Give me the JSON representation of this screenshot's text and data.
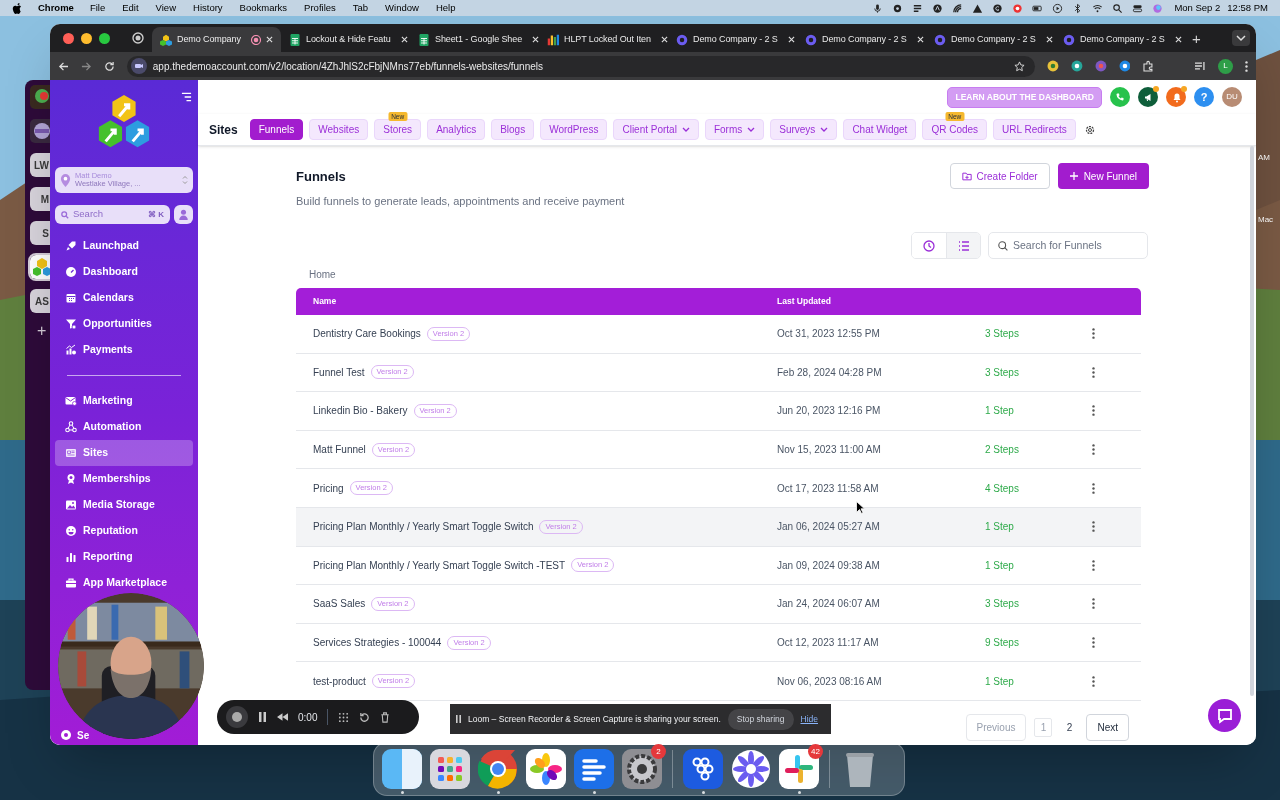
{
  "menu_bar": {
    "app": "Chrome",
    "menus": [
      "File",
      "Edit",
      "View",
      "History",
      "Bookmarks",
      "Profiles",
      "Tab",
      "Window",
      "Help"
    ],
    "date": "Mon Sep 2",
    "time": "12:58 PM"
  },
  "background_app": {
    "workspaces": [
      {
        "kind": "logo",
        "selected": false
      },
      {
        "kind": "logo",
        "selected": false
      },
      {
        "kind": "initials",
        "label": "LW",
        "selected": false
      },
      {
        "kind": "initials",
        "label": "M",
        "selected": false
      },
      {
        "kind": "initials",
        "label": "S",
        "selected": false
      },
      {
        "kind": "logo",
        "selected": true
      },
      {
        "kind": "initials",
        "label": "AS",
        "selected": false
      }
    ],
    "add": "+"
  },
  "desktop_labels": [
    "AM",
    "Mac"
  ],
  "browser": {
    "tabs": [
      {
        "title": "Demo Company",
        "selected": true,
        "recording": true
      },
      {
        "title": "Lockout & Hide Featu",
        "selected": false,
        "recording": false
      },
      {
        "title": "Sheet1 - Google Shee",
        "selected": false,
        "recording": false
      },
      {
        "title": "HLPT Locked Out Iten",
        "selected": false,
        "recording": false
      },
      {
        "title": "Demo Company - 2 S",
        "selected": false,
        "recording": false
      },
      {
        "title": "Demo Company - 2 S",
        "selected": false,
        "recording": false
      },
      {
        "title": "Demo Company - 2 S",
        "selected": false,
        "recording": false
      },
      {
        "title": "Demo Company - 2 S",
        "selected": false,
        "recording": false
      }
    ],
    "new_tab": "+",
    "url": "app.thedemoaccount.com/v2/location/4ZhJhlS2cFbjNMns77eb/funnels-websites/funnels",
    "profile_initial": "L"
  },
  "app": {
    "sidebar": {
      "account": {
        "name": "Matt Demo",
        "location": "Westlake Village, ..."
      },
      "search": {
        "placeholder": "Search",
        "shortcut": "⌘ K"
      },
      "nav_groups": [
        [
          {
            "label": "Launchpad",
            "selected": false
          },
          {
            "label": "Dashboard",
            "selected": false
          },
          {
            "label": "Calendars",
            "selected": false
          },
          {
            "label": "Opportunities",
            "selected": false
          },
          {
            "label": "Payments",
            "selected": false
          }
        ],
        [
          {
            "label": "Marketing",
            "selected": false
          },
          {
            "label": "Automation",
            "selected": false
          },
          {
            "label": "Sites",
            "selected": true
          },
          {
            "label": "Memberships",
            "selected": false
          },
          {
            "label": "Media Storage",
            "selected": false
          },
          {
            "label": "Reputation",
            "selected": false
          },
          {
            "label": "Reporting",
            "selected": false
          },
          {
            "label": "App Marketplace",
            "selected": false
          }
        ]
      ],
      "bottom_item": "Se"
    },
    "header": {
      "learn_button": "LEARN ABOUT THE DASHBOARD",
      "buttons": [
        {
          "notification": false
        },
        {
          "notification": true
        },
        {
          "notification": true
        }
      ],
      "help": "?",
      "avatar": "DU"
    },
    "section_title": "Sites",
    "nav_tabs": [
      {
        "label": "Funnels",
        "selected": true,
        "dropdown": false
      },
      {
        "label": "Websites",
        "selected": false,
        "dropdown": false
      },
      {
        "label": "Stores",
        "selected": false,
        "dropdown": false,
        "badge": "New"
      },
      {
        "label": "Analytics",
        "selected": false,
        "dropdown": false
      },
      {
        "label": "Blogs",
        "selected": false,
        "dropdown": false
      },
      {
        "label": "WordPress",
        "selected": false,
        "dropdown": false
      },
      {
        "label": "Client Portal",
        "selected": false,
        "dropdown": true
      },
      {
        "label": "Forms",
        "selected": false,
        "dropdown": true
      },
      {
        "label": "Surveys",
        "selected": false,
        "dropdown": true
      },
      {
        "label": "Chat Widget",
        "selected": false,
        "dropdown": false
      },
      {
        "label": "QR Codes",
        "selected": false,
        "dropdown": false,
        "badge": "New"
      },
      {
        "label": "URL Redirects",
        "selected": false,
        "dropdown": false
      }
    ],
    "page": {
      "title": "Funnels",
      "subtitle": "Build funnels to generate leads, appointments and receive payment",
      "create_folder": "Create Folder",
      "new_funnel": "New Funnel",
      "view_toggle": [
        {
          "selected": false
        },
        {
          "selected": true
        }
      ],
      "search_placeholder": "Search for Funnels",
      "breadcrumb": "Home",
      "table": {
        "columns": [
          "Name",
          "Last Updated"
        ],
        "rows": [
          {
            "name": "Dentistry Care Bookings",
            "version": "Version 2",
            "updated": "Oct 31, 2023 12:55 PM",
            "steps": "3 Steps",
            "highlighted": false
          },
          {
            "name": "Funnel Test",
            "version": "Version 2",
            "updated": "Feb 28, 2024 04:28 PM",
            "steps": "3 Steps",
            "highlighted": false
          },
          {
            "name": "Linkedin Bio - Bakery",
            "version": "Version 2",
            "updated": "Jun 20, 2023 12:16 PM",
            "steps": "1 Step",
            "highlighted": false
          },
          {
            "name": "Matt Funnel",
            "version": "Version 2",
            "updated": "Nov 15, 2023 11:00 AM",
            "steps": "2 Steps",
            "highlighted": false
          },
          {
            "name": "Pricing",
            "version": "Version 2",
            "updated": "Oct 17, 2023 11:58 AM",
            "steps": "4 Steps",
            "highlighted": false
          },
          {
            "name": "Pricing Plan Monthly / Yearly Smart Toggle Switch",
            "version": "Version 2",
            "updated": "Jan 06, 2024 05:27 AM",
            "steps": "1 Step",
            "highlighted": true
          },
          {
            "name": "Pricing Plan Monthly / Yearly Smart Toggle Switch -TEST",
            "version": "Version 2",
            "updated": "Jan 09, 2024 09:38 AM",
            "steps": "1 Step",
            "highlighted": false
          },
          {
            "name": "SaaS Sales",
            "version": "Version 2",
            "updated": "Jan 24, 2024 06:07 AM",
            "steps": "3 Steps",
            "highlighted": false
          },
          {
            "name": "Services Strategies - 100044",
            "version": "Version 2",
            "updated": "Oct 12, 2023 11:17 AM",
            "steps": "9 Steps",
            "highlighted": false
          },
          {
            "name": "test-product",
            "version": "Version 2",
            "updated": "Nov 06, 2023 08:16 AM",
            "steps": "1 Step",
            "highlighted": false
          }
        ]
      },
      "pagination": {
        "previous": "Previous",
        "previous_disabled": true,
        "pages": [
          {
            "label": "1",
            "selected": true
          },
          {
            "label": "2",
            "selected": false
          }
        ],
        "next": "Next"
      }
    }
  },
  "loom_controls": {
    "timer": "0:00"
  },
  "loom_banner": {
    "message": "Loom – Screen Recorder & Screen Capture is sharing your screen.",
    "stop": "Stop sharing",
    "hide": "Hide"
  },
  "dock": {
    "apps": [
      {
        "running": true
      },
      {
        "running": false
      },
      {
        "running": true
      },
      {
        "running": false
      },
      {
        "running": true
      },
      {
        "running": false,
        "badge": "2"
      },
      {
        "running": true
      },
      {
        "running": false
      },
      {
        "running": true,
        "badge": "42"
      },
      {
        "running": false
      }
    ]
  }
}
